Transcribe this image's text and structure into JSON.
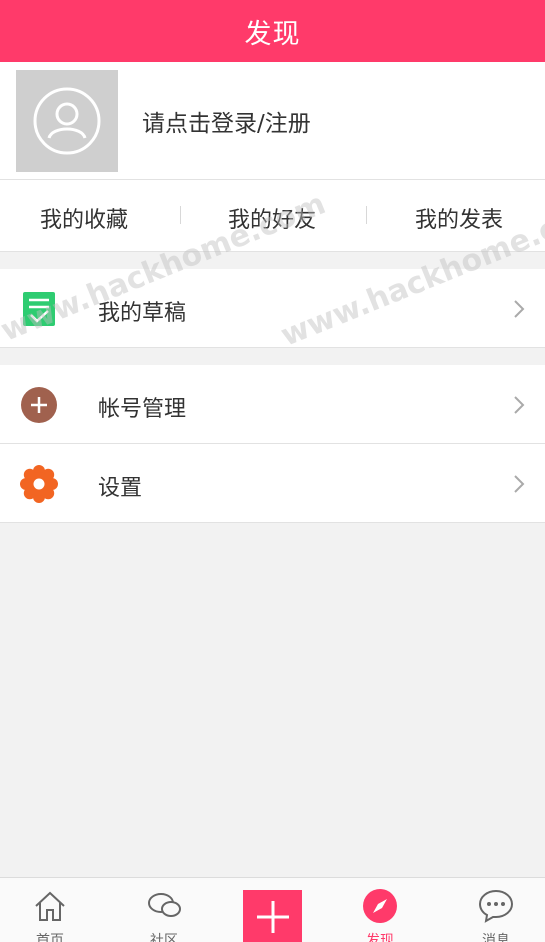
{
  "header": {
    "title": "发现"
  },
  "profile": {
    "login_prompt": "请点击登录/注册"
  },
  "stats": [
    "我的收藏",
    "我的好友",
    "我的发表"
  ],
  "menu": {
    "drafts": "我的草稿",
    "account": "帐号管理",
    "settings": "设置"
  },
  "watermark": "www.hackhome.com",
  "tabbar": {
    "home": "首页",
    "community": "社区",
    "discover": "发现",
    "messages": "消息"
  },
  "colors": {
    "accent": "#ff3a6a",
    "drafts_icon": "#2ecc71",
    "account_icon": "#a0614e",
    "settings_icon": "#f26522"
  }
}
